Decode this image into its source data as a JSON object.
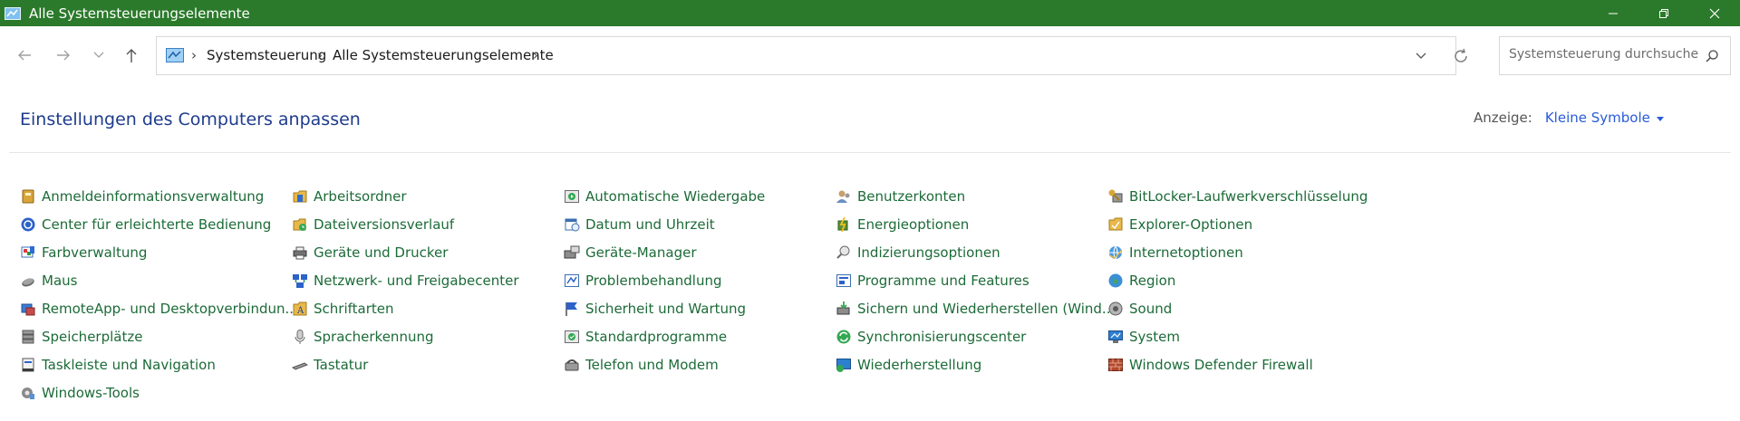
{
  "window": {
    "title": "Alle Systemsteuerungselemente"
  },
  "breadcrumb": [
    "Systemsteuerung",
    "Alle Systemsteuerungselemente"
  ],
  "search": {
    "placeholder": "Systemsteuerung durchsuchen"
  },
  "page": {
    "heading": "Einstellungen des Computers anpassen"
  },
  "view": {
    "label": "Anzeige:",
    "value": "Kleine Symbole"
  },
  "columns": [
    [
      "Anmeldeinformationsverwaltung",
      "Center für erleichterte Bedienung",
      "Farbverwaltung",
      "Maus",
      "RemoteApp- und Desktopverbindun...",
      "Speicherplätze",
      "Taskleiste und Navigation",
      "Windows-Tools"
    ],
    [
      "Arbeitsordner",
      "Dateiversionsverlauf",
      "Geräte und Drucker",
      "Netzwerk- und Freigabecenter",
      "Schriftarten",
      "Spracherkennung",
      "Tastatur"
    ],
    [
      "Automatische Wiedergabe",
      "Datum und Uhrzeit",
      "Geräte-Manager",
      "Problembehandlung",
      "Sicherheit und Wartung",
      "Standardprogramme",
      "Telefon und Modem"
    ],
    [
      "Benutzerkonten",
      "Energieoptionen",
      "Indizierungsoptionen",
      "Programme und Features",
      "Sichern und Wiederherstellen (Wind...",
      "Synchronisierungscenter",
      "Wiederherstellung"
    ],
    [
      "BitLocker-Laufwerkverschlüsselung",
      "Explorer-Optionen",
      "Internetoptionen",
      "Region",
      "Sound",
      "System",
      "Windows Defender Firewall"
    ]
  ],
  "icon_colors": {
    "titlebar": "#2b7a2b",
    "link": "#1c6b38",
    "heading": "#1e3c8c",
    "accent": "#2a5bd7"
  }
}
